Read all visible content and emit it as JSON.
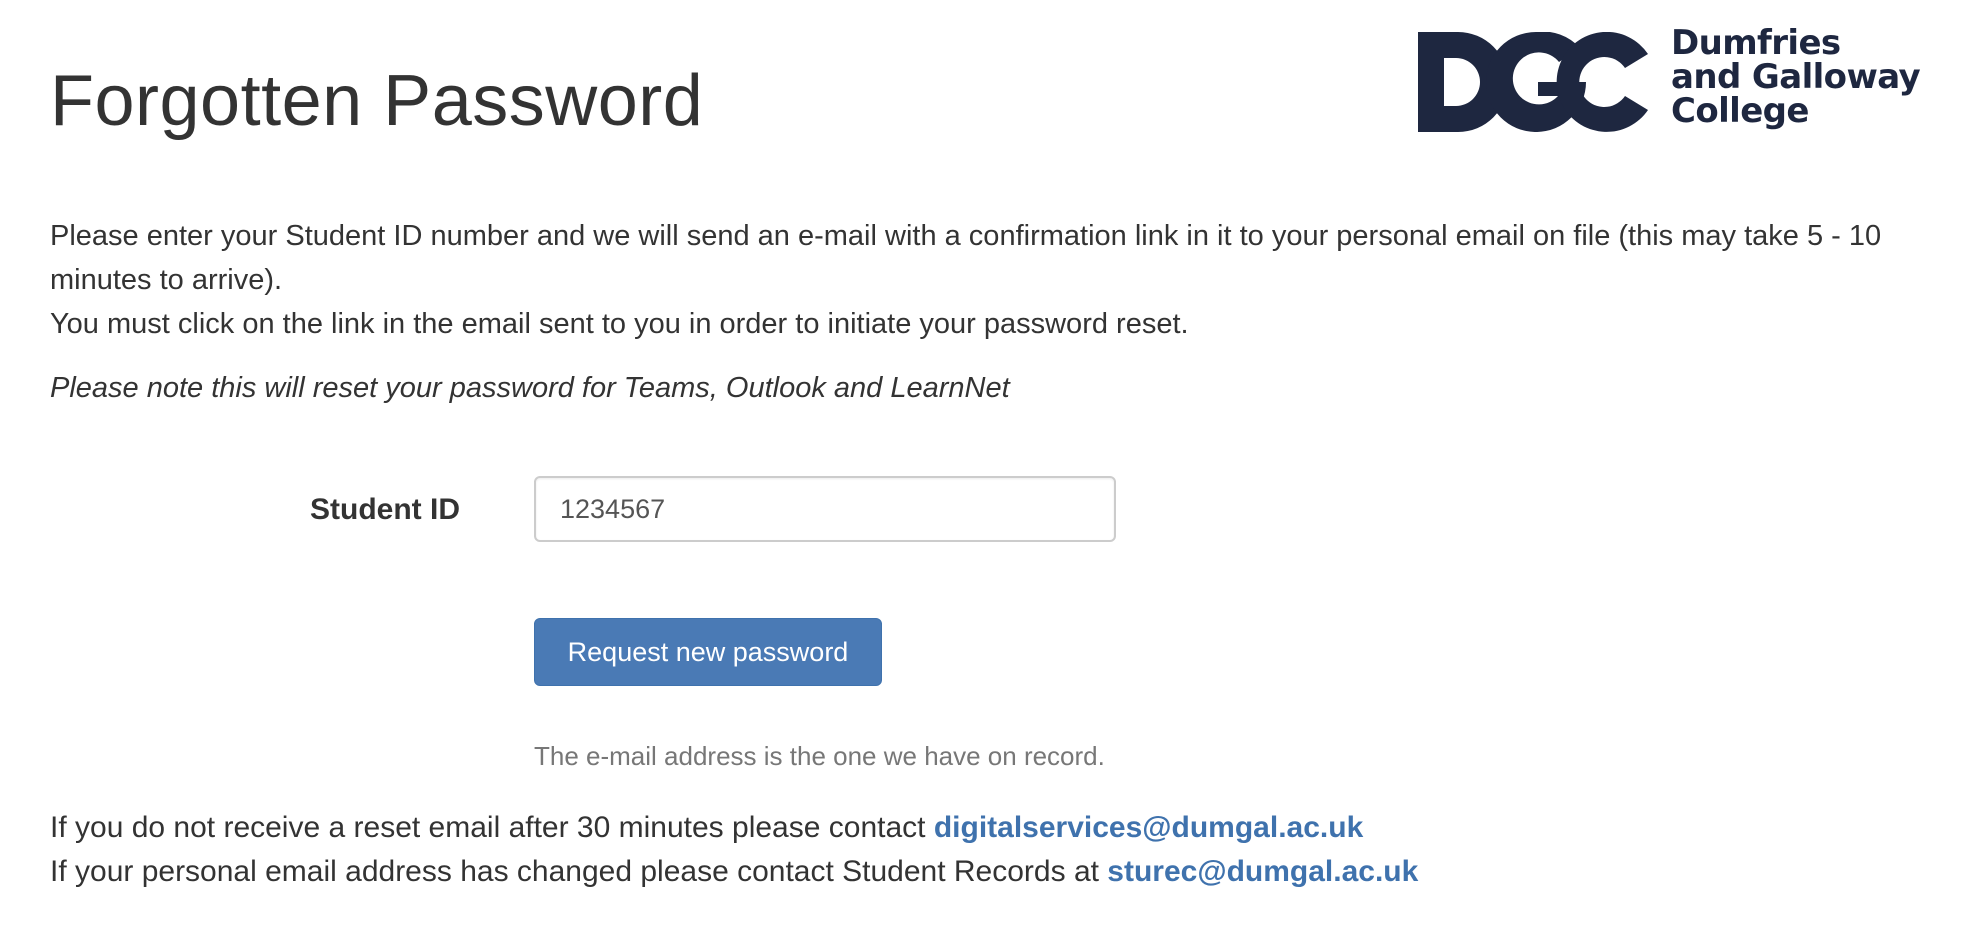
{
  "page": {
    "title": "Forgotten Password"
  },
  "logo": {
    "line1": "Dumfries",
    "line2": "and Galloway",
    "line3": "College",
    "color": "#1e2740"
  },
  "intro": {
    "paragraph1": "Please enter your Student ID number and we will send an e-mail with a confirmation link in it to your personal email on file (this may take 5 - 10 minutes to arrive).",
    "paragraph2": "You must click on the link in the email sent to you in order to initiate your password reset.",
    "note": "Please note this will reset your password for Teams, Outlook and LearnNet"
  },
  "form": {
    "student_id_label": "Student ID",
    "student_id_value": "1234567",
    "submit_label": "Request new password",
    "help_text": "The e-mail address is the one we have on record."
  },
  "contacts": {
    "line1_text": "If you do not receive a reset email after 30 minutes please contact ",
    "line1_email": "digitalservices@dumgal.ac.uk",
    "line2_text": "If your personal email address has changed please contact Student Records at ",
    "line2_email": "sturec@dumgal.ac.uk"
  },
  "colors": {
    "primary": "#4a7ab5",
    "link": "#3f72ad",
    "text": "#333333",
    "muted": "#777777"
  }
}
